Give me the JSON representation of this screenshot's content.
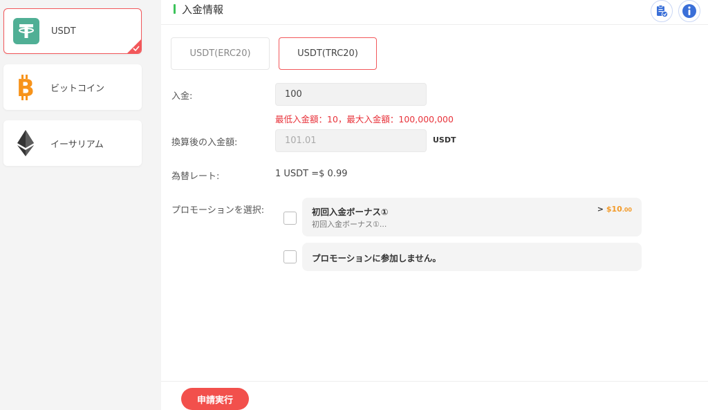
{
  "sidebar": {
    "coins": [
      {
        "label": "USDT",
        "icon": "usdt-icon",
        "color": "#50af95",
        "selected": true
      },
      {
        "label": "ビットコイン",
        "icon": "bitcoin-icon",
        "color": "#f7931a",
        "selected": false
      },
      {
        "label": "イーサリアム",
        "icon": "ethereum-icon",
        "color": "#343434",
        "selected": false
      }
    ]
  },
  "header": {
    "title": "入金情報",
    "buttons": [
      {
        "icon": "clipboard-icon"
      },
      {
        "icon": "info-icon"
      }
    ]
  },
  "tabs": [
    {
      "label": "USDT(ERC20)",
      "active": false
    },
    {
      "label": "USDT(TRC20)",
      "active": true
    }
  ],
  "form": {
    "amount_label": "入金:",
    "amount_value": "100",
    "amount_hint": "最低入金額：10，最大入金額：100,000,000",
    "converted_label": "換算後の入金額:",
    "converted_value": "101.01",
    "converted_unit": "USDT",
    "rate_label": "為替レート:",
    "rate_value": "1  USDT  =$ 0.99",
    "promo_label": "プロモーションを選択:"
  },
  "promotions": [
    {
      "title": "初回入金ボーナス①",
      "subtitle": "初回入金ボーナス①...",
      "amount_prefix": ">",
      "amount": "$10",
      "amount_cents": ".00"
    },
    {
      "title": "プロモーションに参加しません。"
    }
  ],
  "footer": {
    "submit_label": "申請実行"
  },
  "colors": {
    "accent": "#f2575a",
    "title_bar": "#3cc35a",
    "hint": "#e8323a",
    "promo_amount": "#f39b2a"
  }
}
